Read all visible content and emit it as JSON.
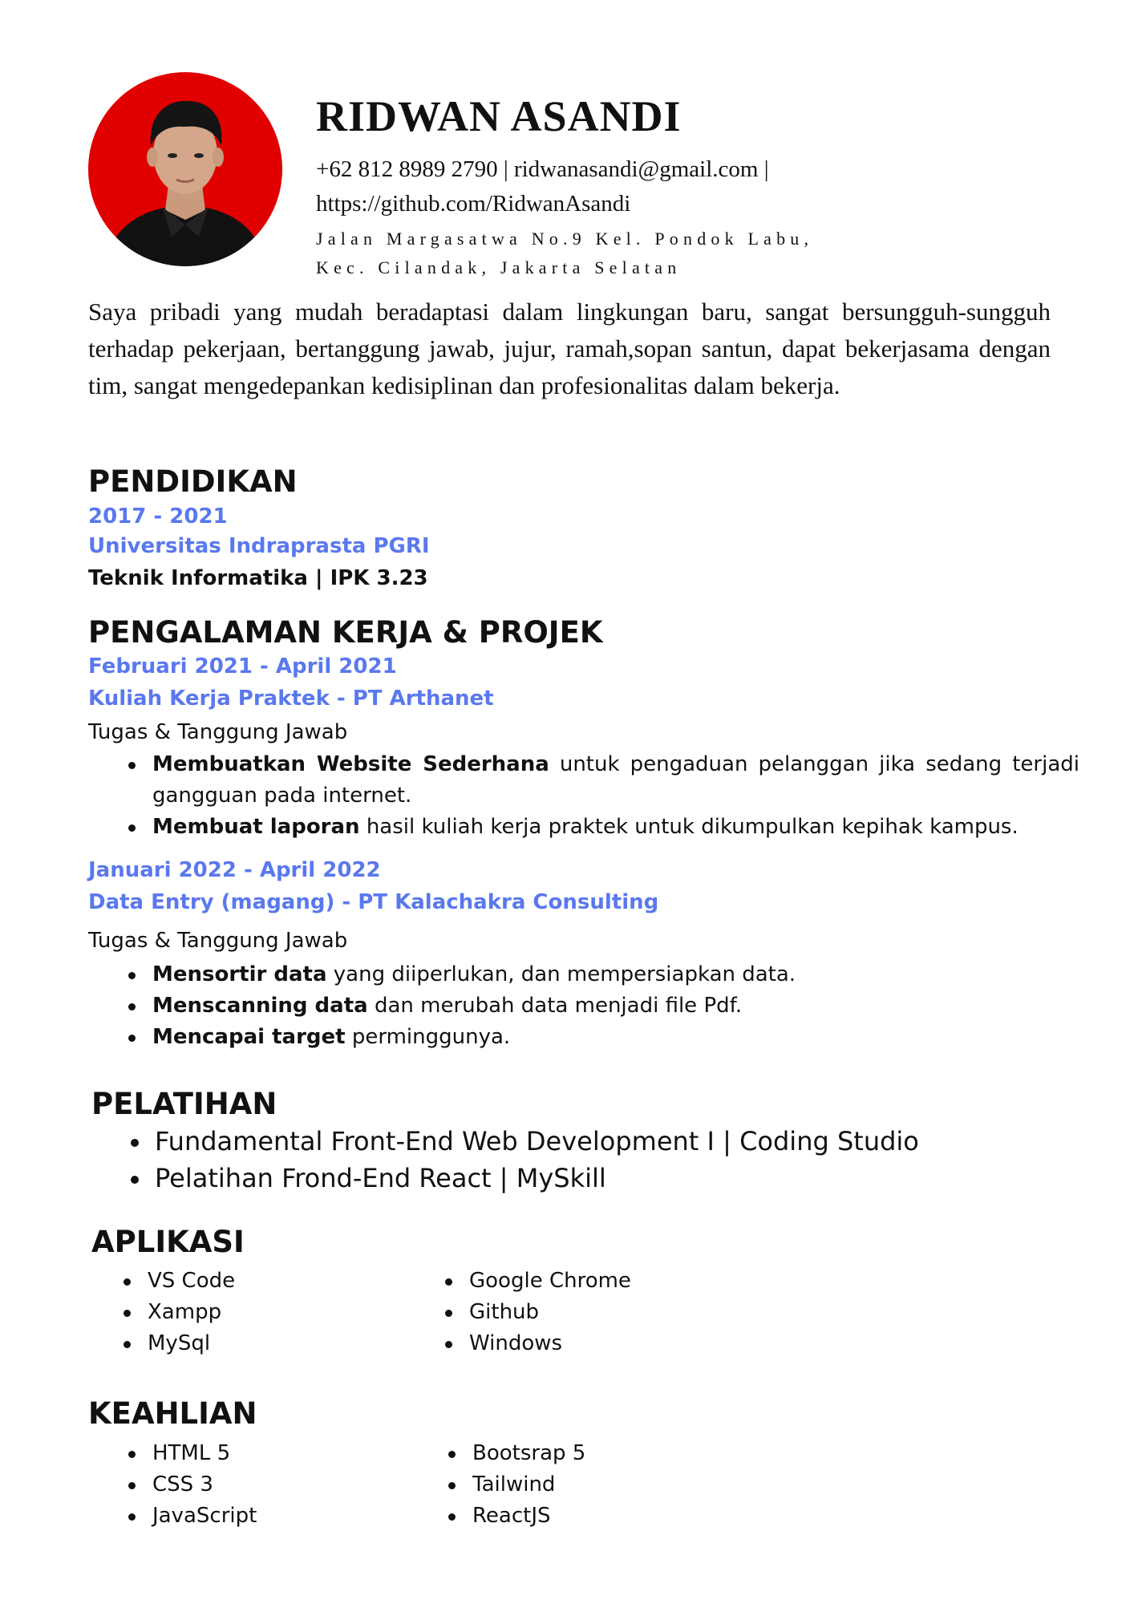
{
  "header": {
    "name": "RIDWAN ASANDI",
    "contact_line1": "+62 812 8989 2790 | ridwanasandi@gmail.com |",
    "contact_line2": "https://github.com/RidwanAsandi",
    "address_line1": "Jalan Margasatwa No.9 Kel. Pondok Labu,",
    "address_line2": "Kec. Cilandak, Jakarta Selatan",
    "photo_background": "#e00000"
  },
  "summary": "Saya pribadi yang mudah beradaptasi dalam lingkungan baru, sangat bersungguh-sungguh terhadap pekerjaan, bertanggung jawab, jujur, ramah,sopan santun, dapat bekerjasama dengan tim, sangat mengedepankan kedisiplinan dan profesionalitas dalam bekerja.",
  "colors": {
    "accent": "#5a78ee",
    "text": "#111111"
  },
  "education": {
    "title": "PENDIDIKAN",
    "years": "2017 - 2021",
    "school": "Universitas Indraprasta PGRI",
    "detail": "Teknik Informatika | IPK 3.23"
  },
  "experience": {
    "title": "PENGALAMAN KERJA & PROJEK",
    "jobs": [
      {
        "period": "Februari 2021 - April 2021",
        "role": "Kuliah Kerja Praktek - PT Arthanet",
        "duties_label": "Tugas & Tanggung Jawab",
        "duties": [
          {
            "bold": "Membuatkan Website Sederhana",
            "text": " untuk pengaduan pelanggan jika sedang terjadi gangguan pada internet."
          },
          {
            "bold": "Membuat laporan",
            "text": " hasil kuliah kerja praktek untuk dikumpulkan kepihak kampus."
          }
        ]
      },
      {
        "period": "Januari 2022 - April 2022",
        "role": "Data Entry (magang) - PT Kalachakra Consulting",
        "duties_label": "Tugas & Tanggung Jawab",
        "duties": [
          {
            "bold": "Mensortir data",
            "text": " yang diiperlukan, dan mempersiapkan data."
          },
          {
            "bold": "Menscanning data",
            "text": " dan merubah data menjadi file Pdf."
          },
          {
            "bold": "Mencapai target",
            "text": " perminggunya."
          }
        ]
      }
    ]
  },
  "training": {
    "title": "PELATIHAN",
    "items": [
      "Fundamental Front-End Web Development I | Coding Studio",
      "Pelatihan Frond-End React | MySkill"
    ]
  },
  "applications": {
    "title": "APLIKASI",
    "col1": [
      "VS Code",
      "Xampp",
      "MySql"
    ],
    "col2": [
      "Google Chrome",
      "Github",
      "Windows"
    ]
  },
  "skills": {
    "title": "KEAHLIAN",
    "col1": [
      "HTML 5",
      "CSS 3",
      "JavaScript"
    ],
    "col2": [
      "Bootsrap 5",
      "Tailwind",
      "ReactJS"
    ]
  }
}
